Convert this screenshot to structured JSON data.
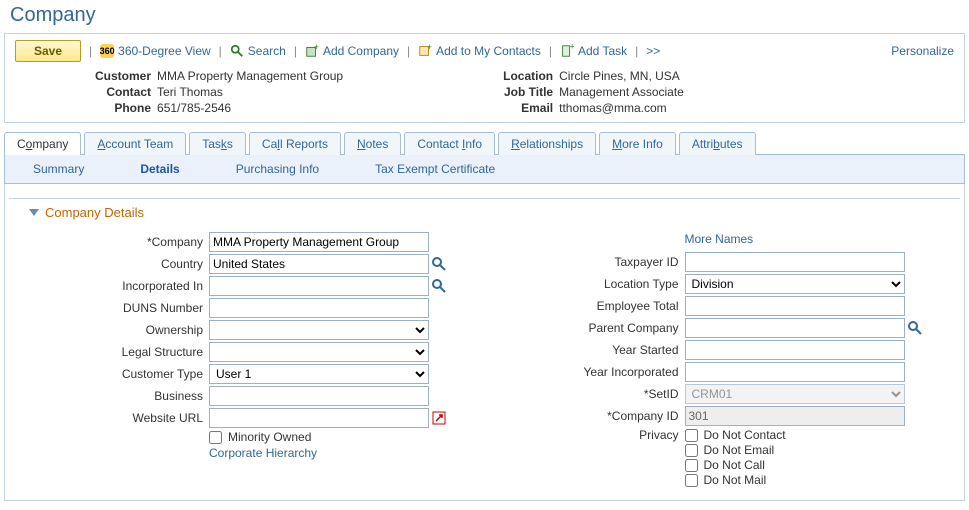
{
  "pageTitle": "Company",
  "toolbar": {
    "save": "Save",
    "view360": "360-Degree View",
    "search": "Search",
    "addCompany": "Add Company",
    "addContacts": "Add to My Contacts",
    "addTask": "Add Task",
    "more": ">>",
    "personalize": "Personalize"
  },
  "summary": {
    "customer_lbl": "Customer",
    "customer": "MMA Property Management Group",
    "contact_lbl": "Contact",
    "contact": "Teri Thomas",
    "phone_lbl": "Phone",
    "phone": "651/785-2546",
    "location_lbl": "Location",
    "location": "Circle Pines, MN, USA",
    "jobtitle_lbl": "Job Title",
    "jobtitle": "Management Associate",
    "email_lbl": "Email",
    "email": "tthomas@mma.com"
  },
  "tabs": {
    "company": {
      "pre": "C",
      "u": "o",
      "post": "mpany"
    },
    "accountTeam": {
      "pre": "",
      "u": "A",
      "post": "ccount Team"
    },
    "tasks": {
      "pre": "Tas",
      "u": "k",
      "post": "s"
    },
    "callReports": {
      "pre": "Ca",
      "u": "l",
      "post": "l Reports"
    },
    "notes": {
      "pre": "",
      "u": "N",
      "post": "otes"
    },
    "contactInfo": {
      "pre": "Contact ",
      "u": "I",
      "post": "nfo"
    },
    "relationships": {
      "pre": "",
      "u": "R",
      "post": "elationships"
    },
    "moreInfo": {
      "pre": "",
      "u": "M",
      "post": "ore Info"
    },
    "attributes": {
      "pre": "Attri",
      "u": "b",
      "post": "utes"
    }
  },
  "subtabs": {
    "summary": "Summary",
    "details": "Details",
    "purchasing": "Purchasing Info",
    "tax": "Tax Exempt Certificate"
  },
  "section": {
    "title": "Company Details"
  },
  "labels": {
    "company": "Company",
    "country": "Country",
    "incorporatedIn": "Incorporated In",
    "duns": "DUNS Number",
    "ownership": "Ownership",
    "legalStructure": "Legal Structure",
    "customerType": "Customer Type",
    "business": "Business",
    "websiteUrl": "Website URL",
    "minorityOwned": "Minority Owned",
    "corpHierarchy": "Corporate Hierarchy",
    "moreNames": "More Names",
    "taxpayerId": "Taxpayer ID",
    "locationType": "Location Type",
    "employeeTotal": "Employee Total",
    "parentCompany": "Parent Company",
    "yearStarted": "Year Started",
    "yearIncorporated": "Year Incorporated",
    "setId": "SetID",
    "companyId": "Company ID",
    "privacy": "Privacy",
    "doNotContact": "Do Not Contact",
    "doNotEmail": "Do Not Email",
    "doNotCall": "Do Not Call",
    "doNotMail": "Do Not Mail"
  },
  "values": {
    "company": "MMA Property Management Group",
    "country": "United States",
    "incorporatedIn": "",
    "duns": "",
    "ownership": "",
    "legalStructure": "",
    "customerType": "User 1",
    "business": "",
    "websiteUrl": "",
    "taxpayerId": "",
    "locationType": "Division",
    "employeeTotal": "",
    "parentCompany": "",
    "yearStarted": "",
    "yearIncorporated": "",
    "setId": "CRM01",
    "companyId": "301"
  }
}
